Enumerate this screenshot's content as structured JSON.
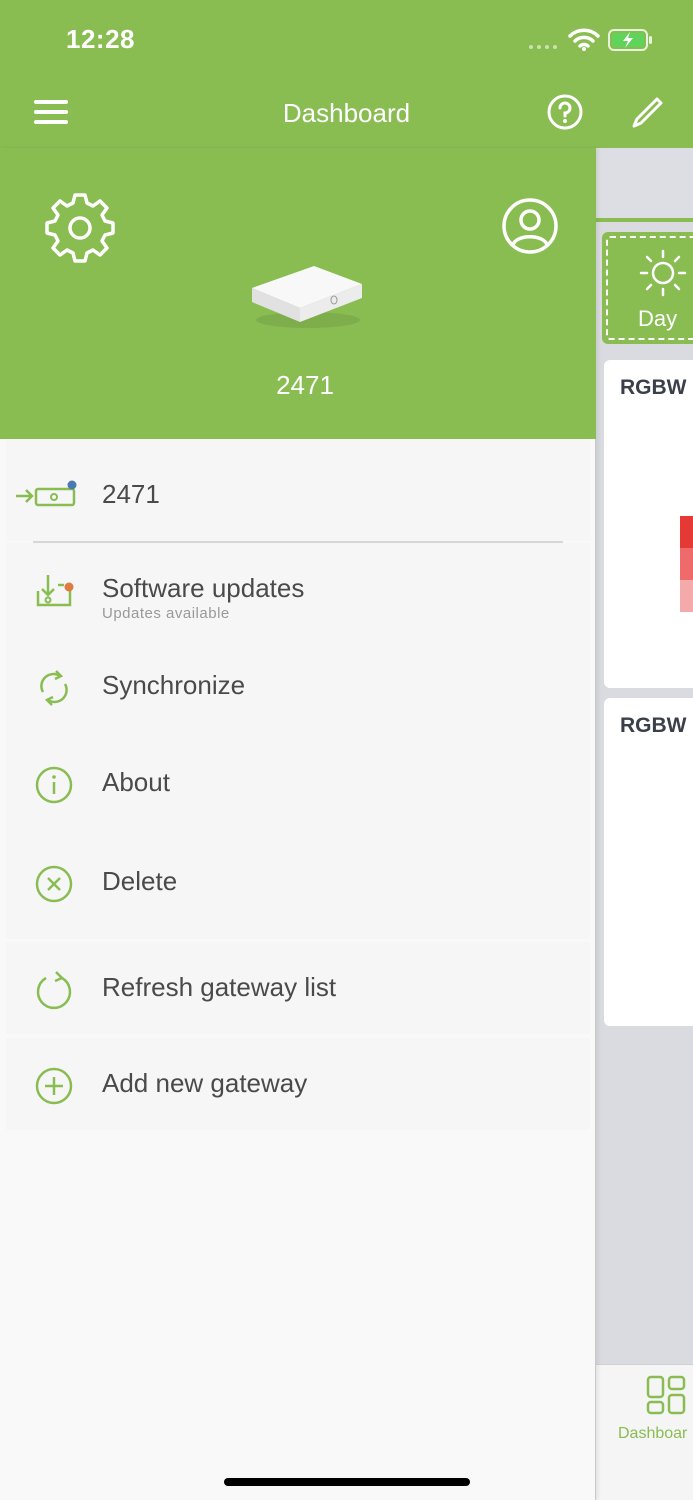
{
  "status_bar": {
    "time": "12:28"
  },
  "header": {
    "title": "Dashboard",
    "menu_icon": "hamburger-menu-icon",
    "help_icon": "help-icon",
    "edit_icon": "pencil-icon"
  },
  "drawer": {
    "settings_icon": "gear-icon",
    "profile_icon": "user-circle-icon",
    "device_name": "2471",
    "gateway": {
      "name": "2471",
      "icon": "gateway-device-icon"
    },
    "items": [
      {
        "label": "Software updates",
        "sub": "Updates available",
        "icon": "download-icon"
      },
      {
        "label": "Synchronize",
        "icon": "sync-icon"
      },
      {
        "label": "About",
        "icon": "info-icon"
      },
      {
        "label": "Delete",
        "icon": "close-circle-icon"
      }
    ],
    "refresh_label": "Refresh gateway list",
    "add_label": "Add new gateway"
  },
  "dashboard_bg": {
    "day_label": "Day",
    "cards": [
      {
        "label": "RGBW"
      },
      {
        "label": "RGBW"
      }
    ],
    "tab_label": "Dashboar"
  },
  "colors": {
    "accent": "#89bd52",
    "update_dot": "#e07a3f",
    "gateway_dot": "#4a7ab0",
    "swatch_red": "#e53935"
  }
}
